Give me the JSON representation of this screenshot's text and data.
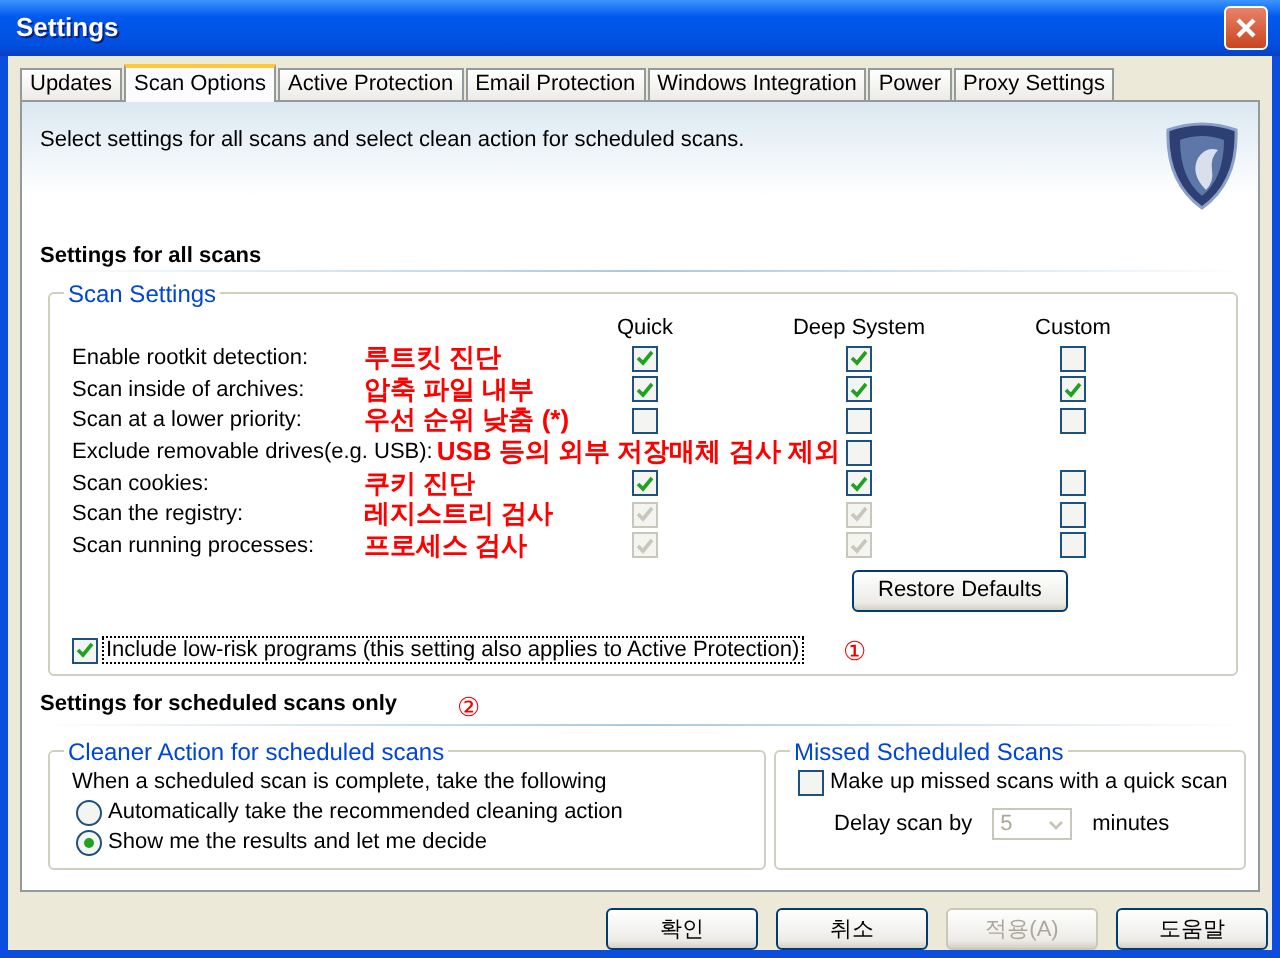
{
  "window": {
    "title": "Settings"
  },
  "tabs": [
    {
      "label": "Updates",
      "selected": false
    },
    {
      "label": "Scan Options",
      "selected": true
    },
    {
      "label": "Active Protection",
      "selected": false
    },
    {
      "label": "Email Protection",
      "selected": false
    },
    {
      "label": "Windows Integration",
      "selected": false
    },
    {
      "label": "Power",
      "selected": false
    },
    {
      "label": "Proxy Settings",
      "selected": false
    }
  ],
  "header": {
    "description": "Select settings for all scans and select clean action for scheduled scans."
  },
  "all_scans": {
    "heading": "Settings for all scans",
    "group_title": "Scan Settings",
    "columns": [
      "Quick",
      "Deep System",
      "Custom"
    ],
    "rows": [
      {
        "label": "Enable rootkit detection:",
        "annotation": "루트킷 진단",
        "quick": {
          "checked": true,
          "disabled": false
        },
        "deep": {
          "checked": true,
          "disabled": false
        },
        "custom": {
          "checked": false,
          "disabled": false
        }
      },
      {
        "label": "Scan inside of archives:",
        "annotation": "압축 파일 내부",
        "quick": {
          "checked": true,
          "disabled": false
        },
        "deep": {
          "checked": true,
          "disabled": false
        },
        "custom": {
          "checked": true,
          "disabled": false
        }
      },
      {
        "label": "Scan at a lower priority:",
        "annotation": "우선 순위 낮춤 (*)",
        "quick": {
          "checked": false,
          "disabled": false
        },
        "deep": {
          "checked": false,
          "disabled": false
        },
        "custom": {
          "checked": false,
          "disabled": false
        }
      },
      {
        "label": "Exclude removable drives(e.g. USB):",
        "annotation": "USB 등의 외부 저장매체 검사 제외",
        "deep": {
          "checked": false,
          "disabled": false
        }
      },
      {
        "label": "Scan cookies:",
        "annotation": "쿠키 진단",
        "quick": {
          "checked": true,
          "disabled": false
        },
        "deep": {
          "checked": true,
          "disabled": false
        },
        "custom": {
          "checked": false,
          "disabled": false
        }
      },
      {
        "label": "Scan the registry:",
        "annotation": "레지스트리 검사",
        "quick": {
          "checked": true,
          "disabled": true
        },
        "deep": {
          "checked": true,
          "disabled": true
        },
        "custom": {
          "checked": false,
          "disabled": false
        }
      },
      {
        "label": "Scan running processes:",
        "annotation": "프로세스 검사",
        "quick": {
          "checked": true,
          "disabled": true
        },
        "deep": {
          "checked": true,
          "disabled": true
        },
        "custom": {
          "checked": false,
          "disabled": false
        }
      }
    ],
    "restore_button": "Restore Defaults",
    "low_risk": {
      "label": "Include low-risk programs (this setting also applies to Active Protection)",
      "checked": true,
      "focused": true,
      "marker": "①"
    }
  },
  "scheduled": {
    "heading": "Settings for scheduled scans only",
    "marker": "②",
    "cleaner": {
      "title": "Cleaner Action for scheduled scans",
      "prompt": "When a scheduled scan is complete, take the following",
      "options": [
        {
          "label": "Automatically take the recommended cleaning action",
          "selected": false
        },
        {
          "label": "Show me the results and let me decide",
          "selected": true
        }
      ]
    },
    "missed": {
      "title": "Missed Scheduled Scans",
      "make_up": {
        "label": "Make up missed scans with a quick scan",
        "checked": false
      },
      "delay": {
        "label": "Delay scan by",
        "value": "5",
        "disabled": true,
        "unit": "minutes"
      }
    }
  },
  "buttons": [
    {
      "label": "확인",
      "disabled": false
    },
    {
      "label": "취소",
      "disabled": false
    },
    {
      "label": "적용(A)",
      "disabled": true
    },
    {
      "label": "도움말",
      "disabled": false
    }
  ]
}
